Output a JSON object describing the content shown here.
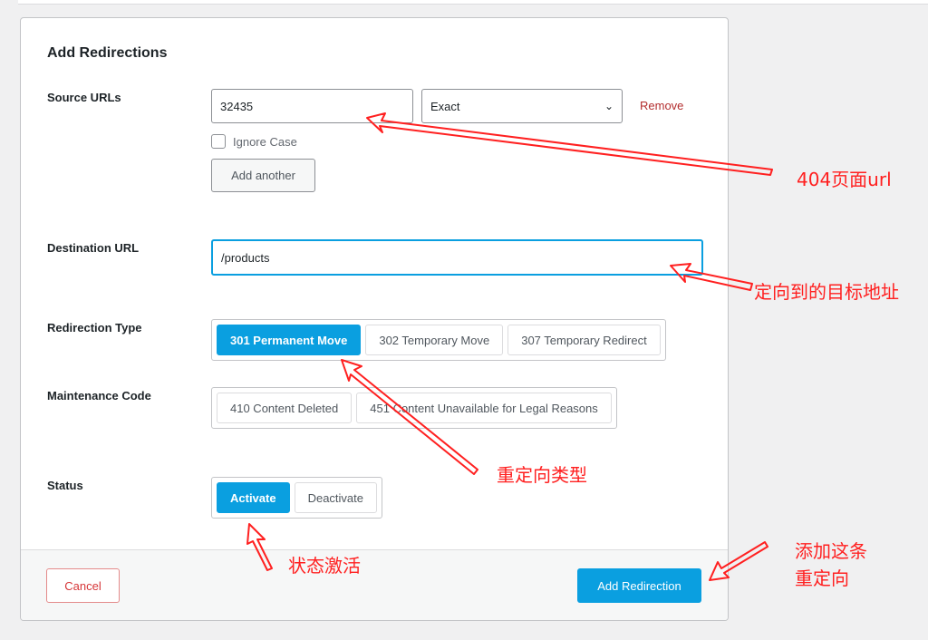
{
  "form": {
    "title": "Add Redirections",
    "source": {
      "label": "Source URLs",
      "value": "32435",
      "match": "Exact",
      "remove": "Remove",
      "ignore_case": "Ignore Case",
      "ignore_case_checked": false,
      "add_another": "Add another"
    },
    "destination": {
      "label": "Destination URL",
      "value": "/products"
    },
    "redirection_type": {
      "label": "Redirection Type",
      "options": [
        "301 Permanent Move",
        "302 Temporary Move",
        "307 Temporary Redirect"
      ],
      "selected": "301 Permanent Move"
    },
    "maintenance": {
      "label": "Maintenance Code",
      "options": [
        "410 Content Deleted",
        "451 Content Unavailable for Legal Reasons"
      ]
    },
    "status": {
      "label": "Status",
      "options": [
        "Activate",
        "Deactivate"
      ],
      "selected": "Activate"
    },
    "cancel": "Cancel",
    "submit": "Add Redirection"
  },
  "annotations": {
    "source": "404页面url",
    "destination": "定向到的目标地址",
    "type": "重定向类型",
    "status": "状态激活",
    "submit_line1": "添加这条",
    "submit_line2": "重定向",
    "color": "#ff2020"
  },
  "colors": {
    "accent": "#0a9fe0",
    "danger": "#b32d2e"
  }
}
